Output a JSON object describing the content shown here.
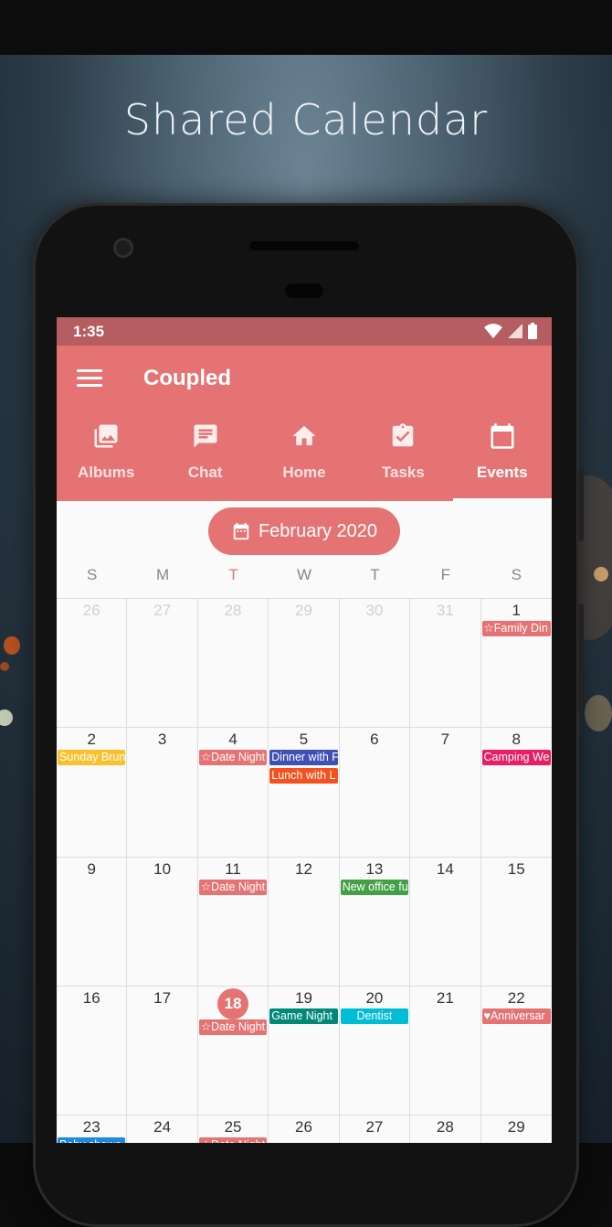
{
  "headline": "Shared Calendar",
  "status": {
    "time": "1:35"
  },
  "app": {
    "title": "Coupled"
  },
  "tabs": [
    {
      "label": "Albums",
      "icon": "photo-library-icon"
    },
    {
      "label": "Chat",
      "icon": "chat-icon"
    },
    {
      "label": "Home",
      "icon": "home-icon"
    },
    {
      "label": "Tasks",
      "icon": "assignment-check-icon"
    },
    {
      "label": "Events",
      "icon": "calendar-icon",
      "active": true
    }
  ],
  "calendar": {
    "month_label": "February 2020",
    "weekdays": [
      "S",
      "M",
      "T",
      "W",
      "T",
      "F",
      "S"
    ],
    "today_weekday_index": 2,
    "weeks": [
      [
        {
          "day": "26",
          "other": true,
          "events": []
        },
        {
          "day": "27",
          "other": true,
          "events": []
        },
        {
          "day": "28",
          "other": true,
          "events": []
        },
        {
          "day": "29",
          "other": true,
          "events": []
        },
        {
          "day": "30",
          "other": true,
          "events": []
        },
        {
          "day": "31",
          "other": true,
          "events": []
        },
        {
          "day": "1",
          "events": [
            {
              "text": "☆Family Din",
              "color": "#e57373"
            }
          ]
        }
      ],
      [
        {
          "day": "2",
          "events": [
            {
              "text": "Sunday Brun",
              "color": "#fbc02d"
            }
          ]
        },
        {
          "day": "3",
          "events": []
        },
        {
          "day": "4",
          "events": [
            {
              "text": "☆Date Night",
              "color": "#e57373"
            }
          ]
        },
        {
          "day": "5",
          "events": [
            {
              "text": "Dinner with F",
              "color": "#3f51b5"
            },
            {
              "text": "Lunch with L",
              "color": "#f4511e"
            }
          ]
        },
        {
          "day": "6",
          "events": []
        },
        {
          "day": "7",
          "events": []
        },
        {
          "day": "8",
          "events": [
            {
              "text": "Camping We",
              "color": "#e91e63"
            }
          ]
        }
      ],
      [
        {
          "day": "9",
          "events": []
        },
        {
          "day": "10",
          "events": []
        },
        {
          "day": "11",
          "events": [
            {
              "text": "☆Date Night",
              "color": "#e57373"
            }
          ]
        },
        {
          "day": "12",
          "events": []
        },
        {
          "day": "13",
          "events": [
            {
              "text": "New office fu",
              "color": "#43a047"
            }
          ]
        },
        {
          "day": "14",
          "events": []
        },
        {
          "day": "15",
          "events": []
        }
      ],
      [
        {
          "day": "16",
          "events": []
        },
        {
          "day": "17",
          "events": []
        },
        {
          "day": "18",
          "selected": true,
          "events": [
            {
              "text": "☆Date Night",
              "color": "#e57373"
            }
          ]
        },
        {
          "day": "19",
          "events": [
            {
              "text": "Game Night",
              "color": "#00897b"
            }
          ]
        },
        {
          "day": "20",
          "events": [
            {
              "text": "Dentist",
              "color": "#00bcd4",
              "center": true
            }
          ]
        },
        {
          "day": "21",
          "events": []
        },
        {
          "day": "22",
          "events": [
            {
              "text": "♥Anniversar",
              "color": "#e57373"
            }
          ]
        }
      ],
      [
        {
          "day": "23",
          "events": [
            {
              "text": "Baby showe",
              "color": "#1e88e5"
            }
          ]
        },
        {
          "day": "24",
          "events": []
        },
        {
          "day": "25",
          "events": [
            {
              "text": "☆Date Night",
              "color": "#e57373"
            }
          ]
        },
        {
          "day": "26",
          "events": []
        },
        {
          "day": "27",
          "events": []
        },
        {
          "day": "28",
          "events": []
        },
        {
          "day": "29",
          "events": []
        }
      ]
    ]
  },
  "colors": {
    "accent": "#e57373",
    "status_bar": "#b55d60"
  }
}
